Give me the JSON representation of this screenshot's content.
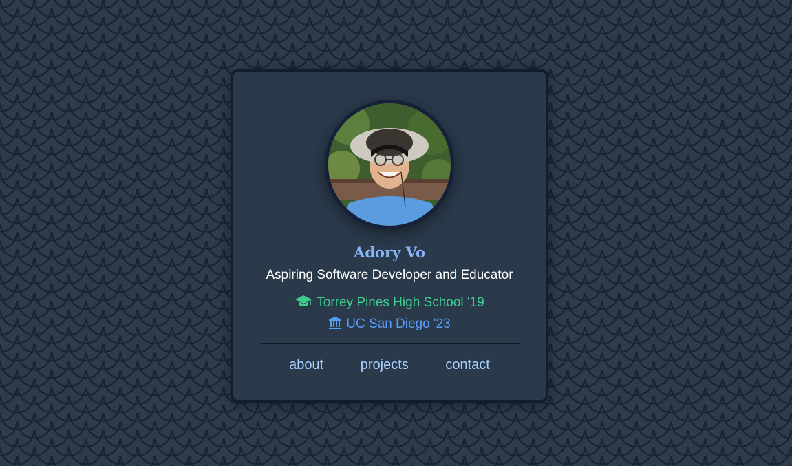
{
  "profile": {
    "name": "Adory Vo",
    "tagline": "Aspiring Software Developer and Educator",
    "photo_icon": "profile-photo"
  },
  "education": [
    {
      "icon": "graduation-cap-icon",
      "label": "Torrey Pines High School '19",
      "color": "#3ecf8e"
    },
    {
      "icon": "university-icon",
      "label": "UC San Diego '23",
      "color": "#5a9cf5"
    }
  ],
  "nav": {
    "about": "about",
    "projects": "projects",
    "contact": "contact"
  },
  "colors": {
    "background": "#2d3b4b",
    "card": "#2a3a4b",
    "card_border": "#131c2a",
    "name": "#8ab4f8",
    "nav_link": "#a8d0ff"
  }
}
